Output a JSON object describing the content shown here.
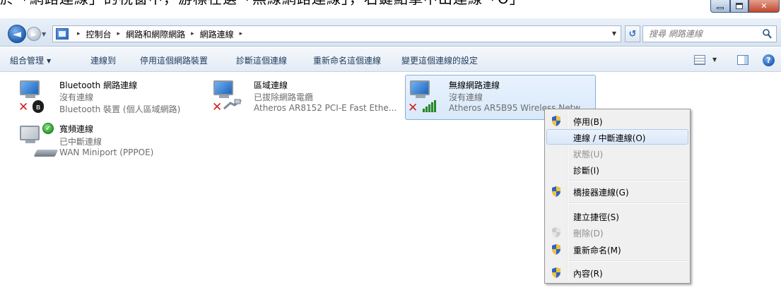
{
  "caption": {
    "text": "於「網路連線」的視窗中，游標在選「無線網路連線」，右鍵點擊中出連線「O」"
  },
  "nav": {
    "back_glyph": "◄",
    "forward_glyph": "►",
    "dropdown_glyph": "▼"
  },
  "address": {
    "crumbs": [
      "控制台",
      "網路和網際網路",
      "網路連線"
    ],
    "separator": "▸",
    "dropdown_glyph": "▼"
  },
  "refresh_glyph": "↺",
  "search": {
    "placeholder": "搜尋 網路連線"
  },
  "toolbar": {
    "organize": "組合管理",
    "connect_to": "連線到",
    "disable_device": "停用這個網路裝置",
    "diagnose": "診斷這個連線",
    "rename": "重新命名這個連線",
    "change_settings": "變更這個連線的設定",
    "dropdown_glyph": "▼",
    "help_glyph": "?"
  },
  "connections": [
    {
      "name": "Bluetooth 網路連線",
      "status": "沒有連線",
      "device": "Bluetooth 裝置 (個人區域網路)"
    },
    {
      "name": "區域連線",
      "status": "已拔除網路電纜",
      "device": "Atheros AR8152 PCI-E Fast Ethe..."
    },
    {
      "name": "無線網路連線",
      "status": "沒有連線",
      "device": "Atheros AR5B95 Wireless Netw..."
    },
    {
      "name": "寬頻連線",
      "status": "已中斷連線",
      "device": "WAN Miniport (PPPOE)"
    }
  ],
  "badges": {
    "red_x": "✕",
    "bluetooth": "ʙ",
    "check": "✓"
  },
  "context_menu": {
    "items": [
      {
        "label": "停用(B)",
        "shield": true,
        "disabled": false
      },
      {
        "label": "連線 / 中斷連線(O)",
        "shield": false,
        "disabled": false,
        "highlighted": true
      },
      {
        "label": "狀態(U)",
        "shield": false,
        "disabled": true
      },
      {
        "label": "診斷(I)",
        "shield": false,
        "disabled": false
      },
      {
        "label": "橋接器連線(G)",
        "shield": true,
        "disabled": false
      },
      {
        "label": "建立捷徑(S)",
        "shield": false,
        "disabled": false
      },
      {
        "label": "刪除(D)",
        "shield": true,
        "disabled": true
      },
      {
        "label": "重新命名(M)",
        "shield": true,
        "disabled": false
      },
      {
        "label": "內容(R)",
        "shield": true,
        "disabled": false
      }
    ]
  },
  "colors": {
    "accent": "#1e395b",
    "selection": "#d8e9fb",
    "error_red": "#d4201c",
    "signal_green": "#2fa52f"
  }
}
